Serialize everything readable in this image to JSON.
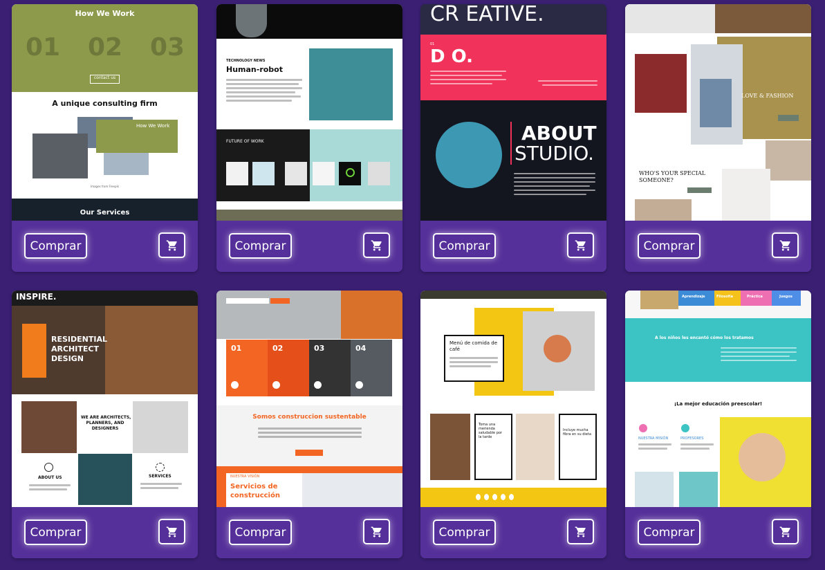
{
  "product_cards": [
    {
      "buy_label": "Comprar",
      "preview": {
        "how_we_work": "How We Work",
        "num1": "01",
        "num2": "02",
        "num3": "03",
        "contact_button": "contact us",
        "headline": "A unique consulting firm",
        "card_title": "How We Work",
        "images_credit": "Images from Freepik",
        "services": "Our Services"
      }
    },
    {
      "buy_label": "Comprar",
      "preview": {
        "kicker": "TECHNOLOGY NEWS",
        "headline": "Human-robot",
        "section": "FUTURE OF WORK"
      }
    },
    {
      "buy_label": "Comprar",
      "preview": {
        "creative": "CR EATIVE.",
        "do": "D O.",
        "about": "ABOUT",
        "studio": "STUDIO."
      }
    },
    {
      "buy_label": "Comprar",
      "preview": {
        "love_fashion": "LOVE & FASHION",
        "special_1": "WHO'S YOUR SPECIAL",
        "special_2": "SOMEONE?"
      }
    },
    {
      "buy_label": "Comprar",
      "preview": {
        "inspire": "INSPIRE.",
        "residential_1": "RESIDENTIAL",
        "residential_2": "ARCHITECT",
        "residential_3": "DESIGN",
        "architects_1": "WE ARE ARCHITECTS,",
        "architects_2": "PLANNERS, AND",
        "architects_3": "DESIGNERS",
        "about_us": "ABOUT US",
        "services": "SERVICES"
      }
    },
    {
      "buy_label": "Comprar",
      "preview": {
        "step1": "01",
        "step2": "02",
        "step3": "03",
        "step4": "04",
        "headline": "Somos construccion sustentable",
        "vision_label": "NUESTRA VISIÓN",
        "vision_1": "Servicios de",
        "vision_2": "construcción"
      }
    },
    {
      "buy_label": "Comprar",
      "preview": {
        "menu_1": "Menú de comida de",
        "menu_2": "café",
        "box1_1": "Toma una",
        "box1_2": "merienda",
        "box1_3": "saludable por",
        "box1_4": "la tarde",
        "box2_1": "Incluye mucha",
        "box2_2": "fibra en su dieta"
      }
    },
    {
      "buy_label": "Comprar",
      "preview": {
        "tab1": "Aprendizaje",
        "tab2": "Filosofía",
        "tab3": "Práctica",
        "tab4": "Juegos",
        "banner": "A los niños les encantó cómo los tratamos",
        "headline": "¡La mejor educación preescolar!",
        "mision": "NUESTRA MISIÓN",
        "profesores": "PROFESORES"
      }
    }
  ]
}
